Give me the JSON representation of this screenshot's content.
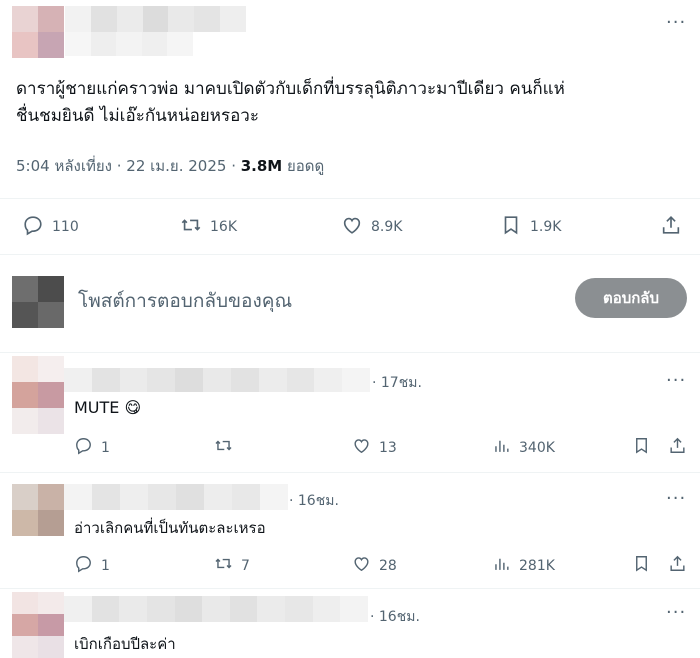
{
  "post": {
    "text_line1": "ดาราผู้ชายแก่คราวพ่อ มาคบเปิดตัวกับเด็กที่บรรลุนิติภาวะมาปีเดียว คนก็แห่",
    "text_line2": "ชื่นชมยินดี ไม่เอ๊ะกันหน่อยหรอวะ",
    "time": "5:04 หลังเที่ยง · 22 เม.ย. 2025 · ",
    "views_value": "3.8M",
    "views_label": " ยอดดู",
    "more": "···",
    "stats": {
      "replies": "110",
      "reposts": "16K",
      "likes": "8.9K",
      "bookmarks": "1.9K"
    }
  },
  "composer": {
    "placeholder": "โพสต์การตอบกลับของคุณ",
    "reply_button": "ตอบกลับ"
  },
  "replies": [
    {
      "time": "· 17ชม.",
      "text": "MUTE",
      "emoji": "😋",
      "more": "···",
      "stats": {
        "replies": "1",
        "reposts": "",
        "likes": "13",
        "views": "340K"
      }
    },
    {
      "time": "· 16ชม.",
      "text": "อ่าวเลิกคนที่เป็นทันตะละเหรอ",
      "more": "···",
      "stats": {
        "replies": "1",
        "reposts": "7",
        "likes": "28",
        "views": "281K"
      }
    },
    {
      "time": "· 16ชม.",
      "text": "เบิกเกือบปีละค่า",
      "more": "···"
    }
  ],
  "colors": {
    "text": "#0f1419",
    "secondary": "#536471",
    "divider": "#eff3f4",
    "reply_button_bg": "#8b8f92"
  }
}
